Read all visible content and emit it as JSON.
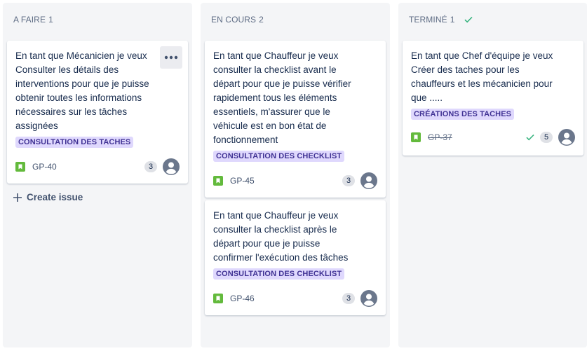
{
  "columns": [
    {
      "title": "A FAIRE",
      "count": "1",
      "cards": [
        {
          "title": "En tant que Mécanicien je veux Consulter les détails des interventions pour que je puisse obtenir toutes les informations nécessaires sur les tâches assignées",
          "label": "CONSULTATION DES TACHES",
          "key": "GP-40",
          "points": "3"
        }
      ],
      "create_label": "Create issue"
    },
    {
      "title": "EN COURS",
      "count": "2",
      "cards": [
        {
          "title": "En tant que Chauffeur je veux consulter la checklist avant le départ pour que je puisse vérifier rapidement tous les éléments essentiels, m'assurer que le véhicule est en bon état de fonctionnement",
          "label": "CONSULTATION DES CHECKLIST",
          "key": "GP-45",
          "points": "3"
        },
        {
          "title": "En tant que Chauffeur je veux consulter la checklist après le départ pour que je puisse confirmer l'exécution des tâches",
          "label": "CONSULTATION DES CHECKLIST",
          "key": "GP-46",
          "points": "3"
        }
      ]
    },
    {
      "title": "TERMINÉ",
      "count": "1",
      "cards": [
        {
          "title": "En tant que Chef d'équipe je veux Créer des taches pour les chauffeurs et les mécanicien pour que .....",
          "label": "CRÉATIONS DES TACHES",
          "key": "GP-37",
          "points": "5"
        }
      ]
    }
  ],
  "colors": {
    "accent_green": "#36b37e",
    "story_green": "#63ba3c",
    "label_bg": "#dfd8fd",
    "label_text": "#403294",
    "column_bg": "#f4f5f7"
  },
  "icons": {
    "story": "bookmark-story-icon",
    "avatar": "user-avatar-icon",
    "more": "more-dots-icon",
    "plus": "plus-icon",
    "check": "check-icon"
  }
}
